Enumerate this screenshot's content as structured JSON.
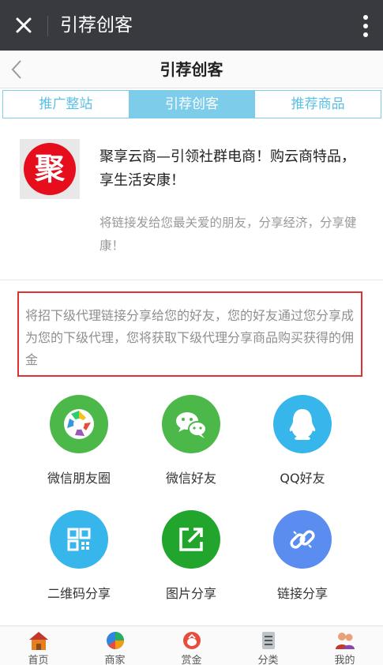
{
  "wechat_bar": {
    "title": "引荐创客"
  },
  "header": {
    "title": "引荐创客"
  },
  "tabs": [
    {
      "label": "推广整站",
      "active": false
    },
    {
      "label": "引荐创客",
      "active": true
    },
    {
      "label": "推荐商品",
      "active": false
    }
  ],
  "share_card": {
    "logo_text": "聚",
    "title": "聚享云商—引领社群电商！购云商特品，享生活安康！",
    "description": "将链接发给您最关爱的朋友，分享经济，分享健康！"
  },
  "notice": "将招下级代理链接分享给您的好友，您的好友通过您分享成为您的下级代理，您将获取下级代理分享商品购买获得的佣金",
  "share_options": [
    {
      "label": "微信朋友圈",
      "icon": "wechat-moments-icon",
      "color": "#4cb849"
    },
    {
      "label": "微信好友",
      "icon": "wechat-icon",
      "color": "#4cb849"
    },
    {
      "label": "QQ好友",
      "icon": "qq-icon",
      "color": "#36b6ea"
    },
    {
      "label": "二维码分享",
      "icon": "qrcode-icon",
      "color": "#36b6ea"
    },
    {
      "label": "图片分享",
      "icon": "image-share-icon",
      "color": "#22a52d"
    },
    {
      "label": "链接分享",
      "icon": "link-icon",
      "color": "#5a8def"
    }
  ],
  "bottom_nav": [
    {
      "label": "首页",
      "icon": "home-icon"
    },
    {
      "label": "商家",
      "icon": "merchant-icon"
    },
    {
      "label": "赏金",
      "icon": "bounty-icon"
    },
    {
      "label": "分类",
      "icon": "category-icon"
    },
    {
      "label": "我的",
      "icon": "profile-icon"
    }
  ],
  "colors": {
    "tab_accent": "#7dcdea",
    "notice_border": "#e1302f",
    "logo_red": "#e60d1c"
  }
}
